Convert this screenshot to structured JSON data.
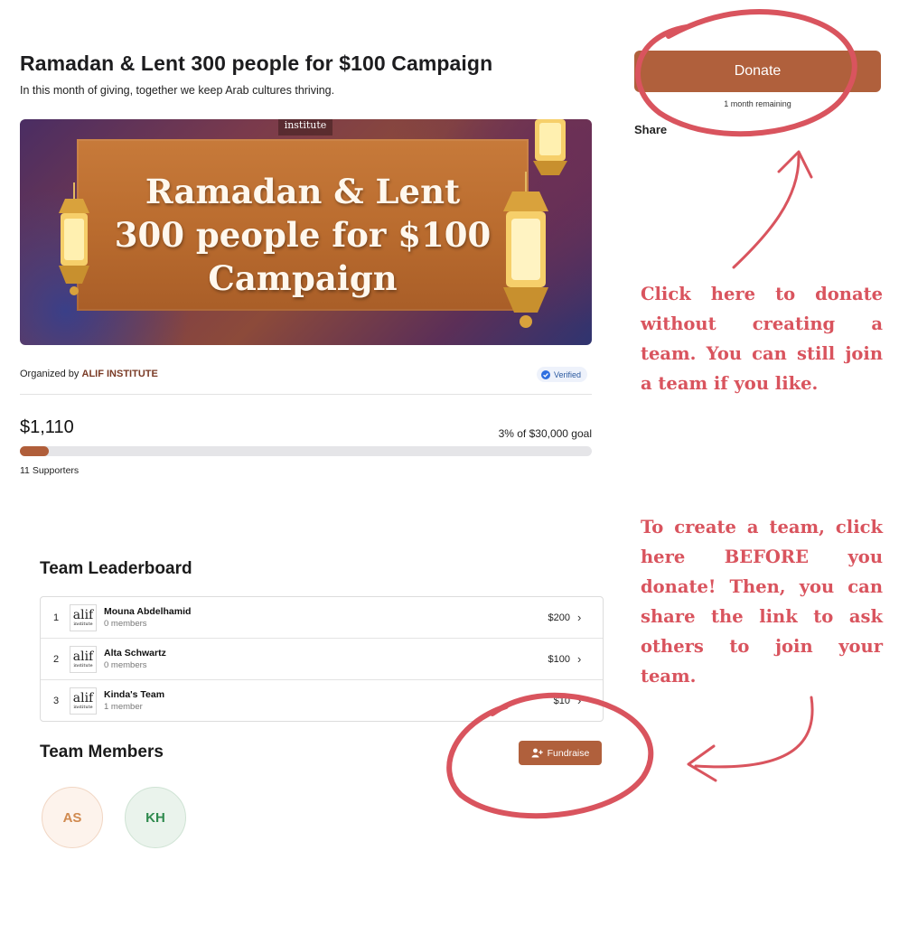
{
  "campaign": {
    "title": "Ramadan & Lent 300 people for $100 Campaign",
    "subtitle": "In this month of giving, together we keep Arab cultures thriving.",
    "banner": {
      "logo_text": "institute",
      "lines": [
        "Ramadan & Lent",
        "300 people for $100",
        "Campaign"
      ]
    },
    "organizer_prefix": "Organized by",
    "organizer_name": "ALIF INSTITUTE",
    "verified_label": "Verified",
    "raised": "$1,110",
    "goal_text": "3% of $30,000 goal",
    "progress_fraction": 0.05,
    "supporters": "11 Supporters"
  },
  "sidebar": {
    "donate_label": "Donate",
    "remaining": "1 month remaining",
    "share_label": "Share"
  },
  "leaderboard": {
    "title": "Team Leaderboard",
    "teams": [
      {
        "rank": "1",
        "name": "Mouna Abdelhamid",
        "members": "0 members",
        "amount": "$200"
      },
      {
        "rank": "2",
        "name": "Alta Schwartz",
        "members": "0 members",
        "amount": "$100"
      },
      {
        "rank": "3",
        "name": "Kinda's Team",
        "members": "1 member",
        "amount": "$10"
      }
    ],
    "logo": {
      "mark": "alif",
      "sub": "institute"
    }
  },
  "team_members": {
    "title": "Team Members",
    "fundraise_label": "Fundraise",
    "avatars": [
      {
        "initials": "AS"
      },
      {
        "initials": "KH"
      }
    ]
  },
  "annotations": {
    "note_donate": "Click here to donate without creating a team. You can still join a team if you like.",
    "note_team": "To create a team, click here BEFORE you donate! Then, you can share the link to ask others to join your team."
  },
  "colors": {
    "accent": "#b0603c",
    "annotation": "#d9545e",
    "verified": "#2c5aa0"
  },
  "icons": [
    "verified-check-icon",
    "chevron-right-icon",
    "add-user-icon",
    "lantern-icon"
  ]
}
